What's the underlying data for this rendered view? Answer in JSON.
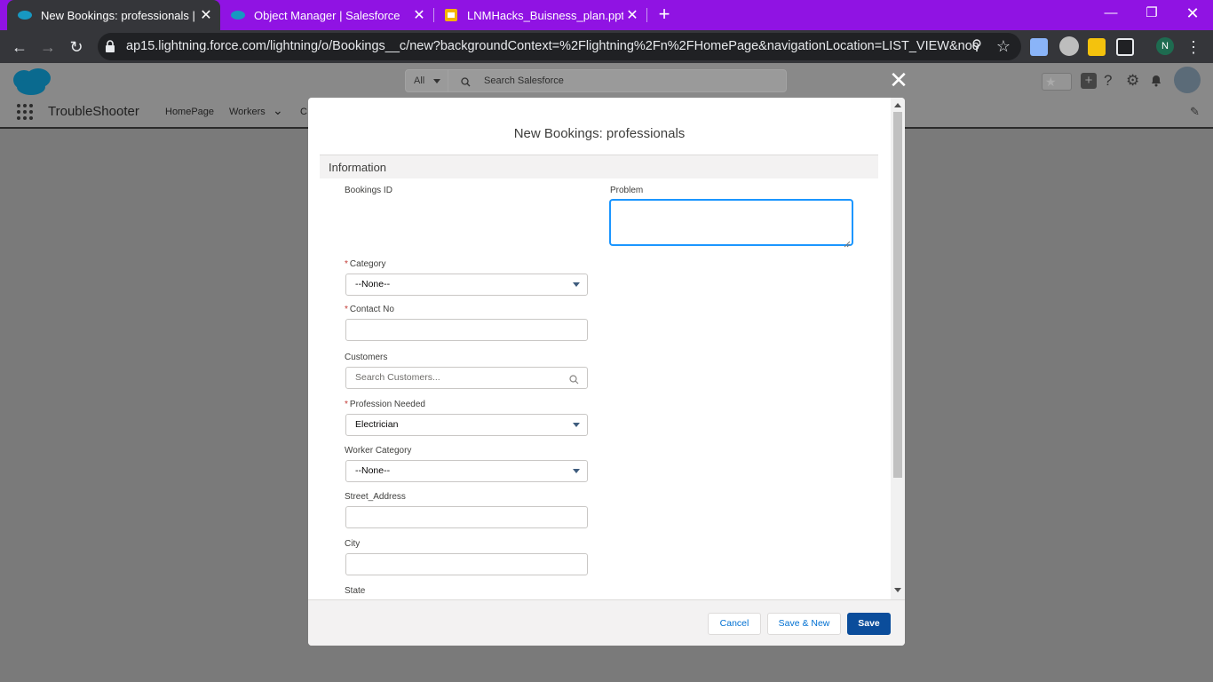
{
  "browser": {
    "tabs": [
      {
        "title": "New Bookings: professionals | Sa",
        "icon": "salesforce-icon",
        "active": true
      },
      {
        "title": "Object Manager | Salesforce",
        "icon": "salesforce-icon",
        "active": false
      },
      {
        "title": "LNMHacks_Buisness_plan.pptx - ",
        "icon": "slides-icon",
        "active": false
      }
    ],
    "url": "ap15.lightning.force.com/lightning/o/Bookings__c/new?backgroundContext=%2Flightning%2Fn%2FHomePage&navigationLocation=LIST_VIEW&noo...",
    "profile_initial": "N"
  },
  "salesforce": {
    "search": {
      "scope": "All",
      "placeholder": "Search Salesforce"
    },
    "app_name": "TroubleShooter",
    "nav": [
      "HomePage",
      "Workers",
      "C"
    ]
  },
  "modal": {
    "title": "New Bookings: professionals",
    "section": "Information",
    "fields": {
      "bookings_id": {
        "label": "Bookings ID"
      },
      "problem": {
        "label": "Problem",
        "value": ""
      },
      "category": {
        "label": "Category",
        "required": "*",
        "value": "--None--"
      },
      "contact_no": {
        "label": "Contact No",
        "required": "*",
        "value": ""
      },
      "customers": {
        "label": "Customers",
        "placeholder": "Search Customers..."
      },
      "profession_needed": {
        "label": "Profession Needed",
        "required": "*",
        "value": "Electrician"
      },
      "worker_category": {
        "label": "Worker Category",
        "value": "--None--"
      },
      "street_address": {
        "label": "Street_Address",
        "value": ""
      },
      "city": {
        "label": "City",
        "value": ""
      },
      "state": {
        "label": "State"
      }
    },
    "buttons": {
      "cancel": "Cancel",
      "save_new": "Save & New",
      "save": "Save"
    }
  },
  "colors": {
    "tabbar": "#9013e3",
    "brand": "#0b4d9b",
    "focus": "#1b96ff"
  }
}
